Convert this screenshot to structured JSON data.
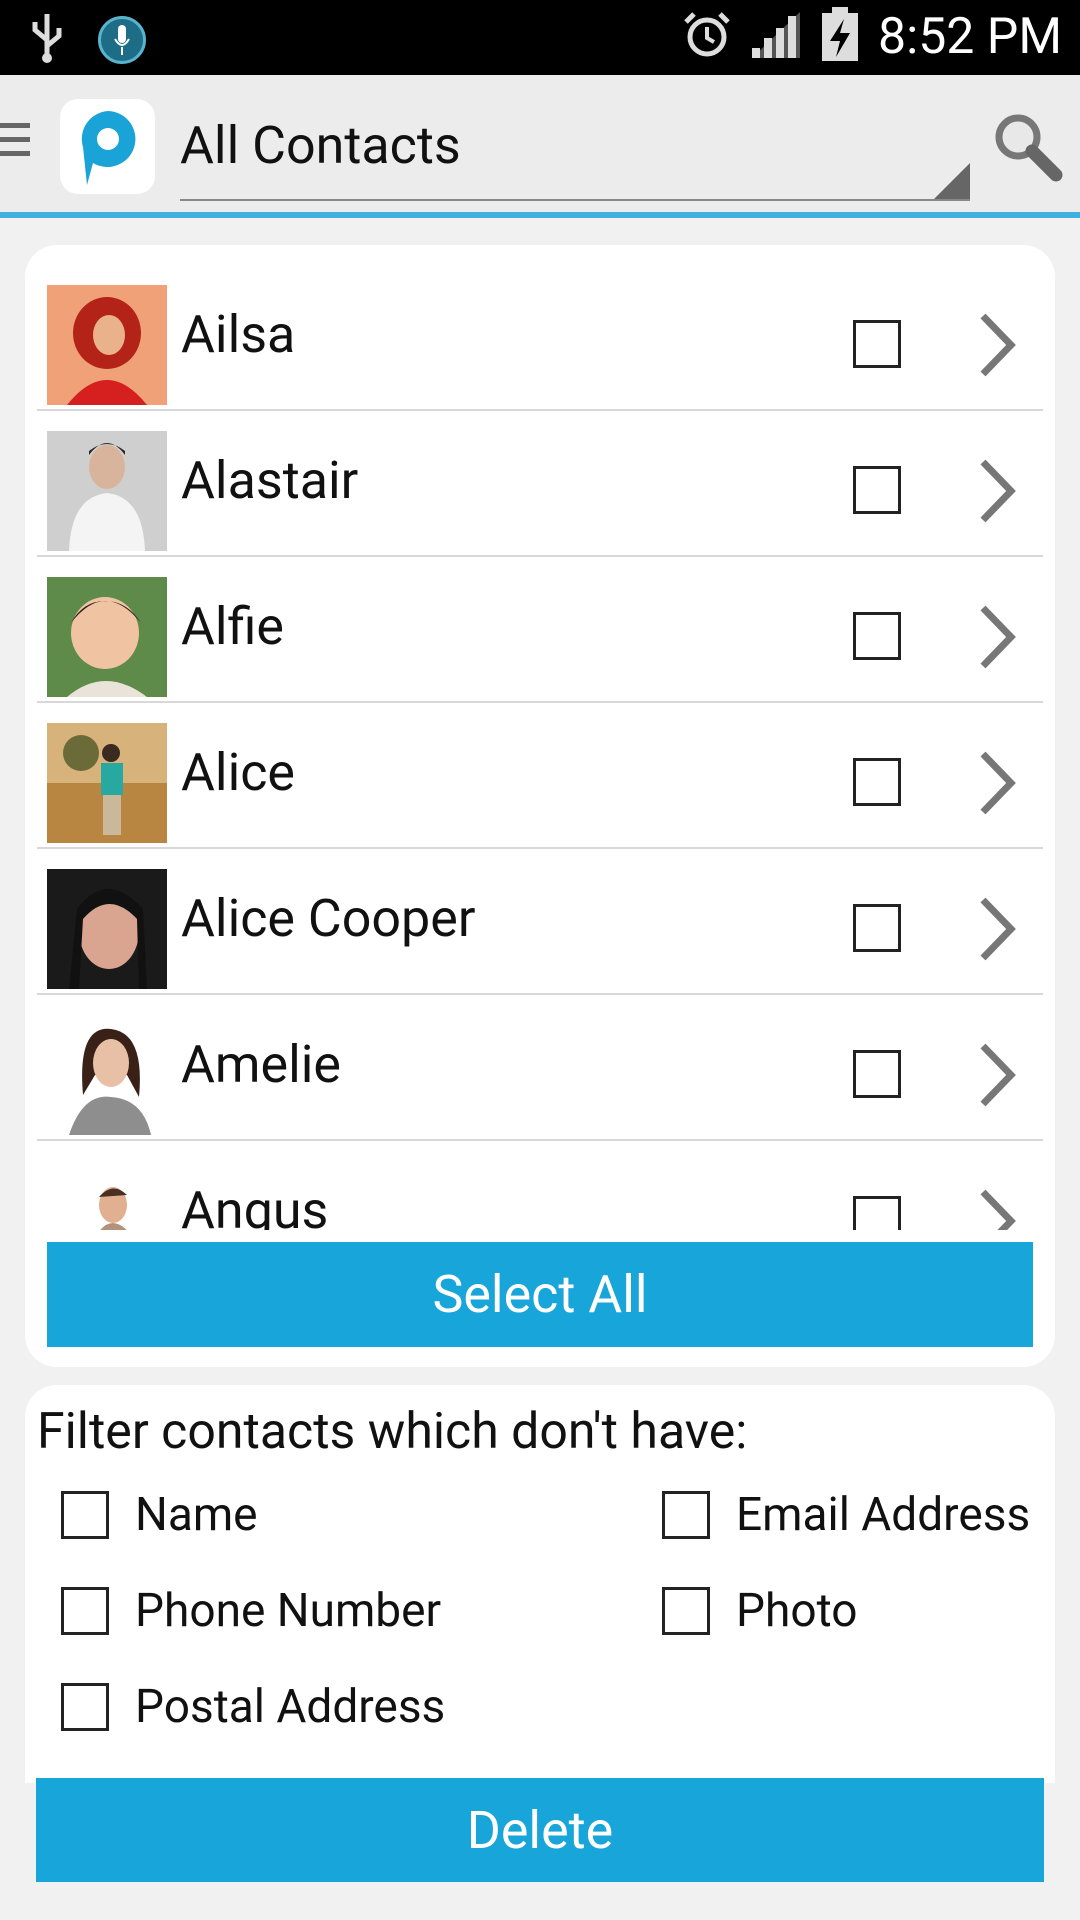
{
  "status_bar": {
    "time": "8:52 PM",
    "icons": [
      "usb-icon",
      "mic-icon",
      "alarm-icon",
      "signal-icon",
      "battery-charging-icon"
    ]
  },
  "action_bar": {
    "title": "All Contacts",
    "icons": [
      "menu-icon",
      "app-logo-icon",
      "search-icon"
    ],
    "accent": "#3fb0e0"
  },
  "contacts": [
    {
      "name": "Ailsa"
    },
    {
      "name": "Alastair"
    },
    {
      "name": "Alfie"
    },
    {
      "name": "Alice"
    },
    {
      "name": "Alice Cooper"
    },
    {
      "name": "Amelie"
    },
    {
      "name": "Angus"
    }
  ],
  "select_all_label": "Select All",
  "filter": {
    "title": "Filter contacts which don't have:",
    "options": [
      {
        "label": "Name"
      },
      {
        "label": "Email Address"
      },
      {
        "label": "Phone Number"
      },
      {
        "label": "Photo"
      },
      {
        "label": "Postal Address"
      }
    ]
  },
  "delete_label": "Delete",
  "colors": {
    "button_blue": "#18a5da",
    "background": "#f1f1f1"
  }
}
